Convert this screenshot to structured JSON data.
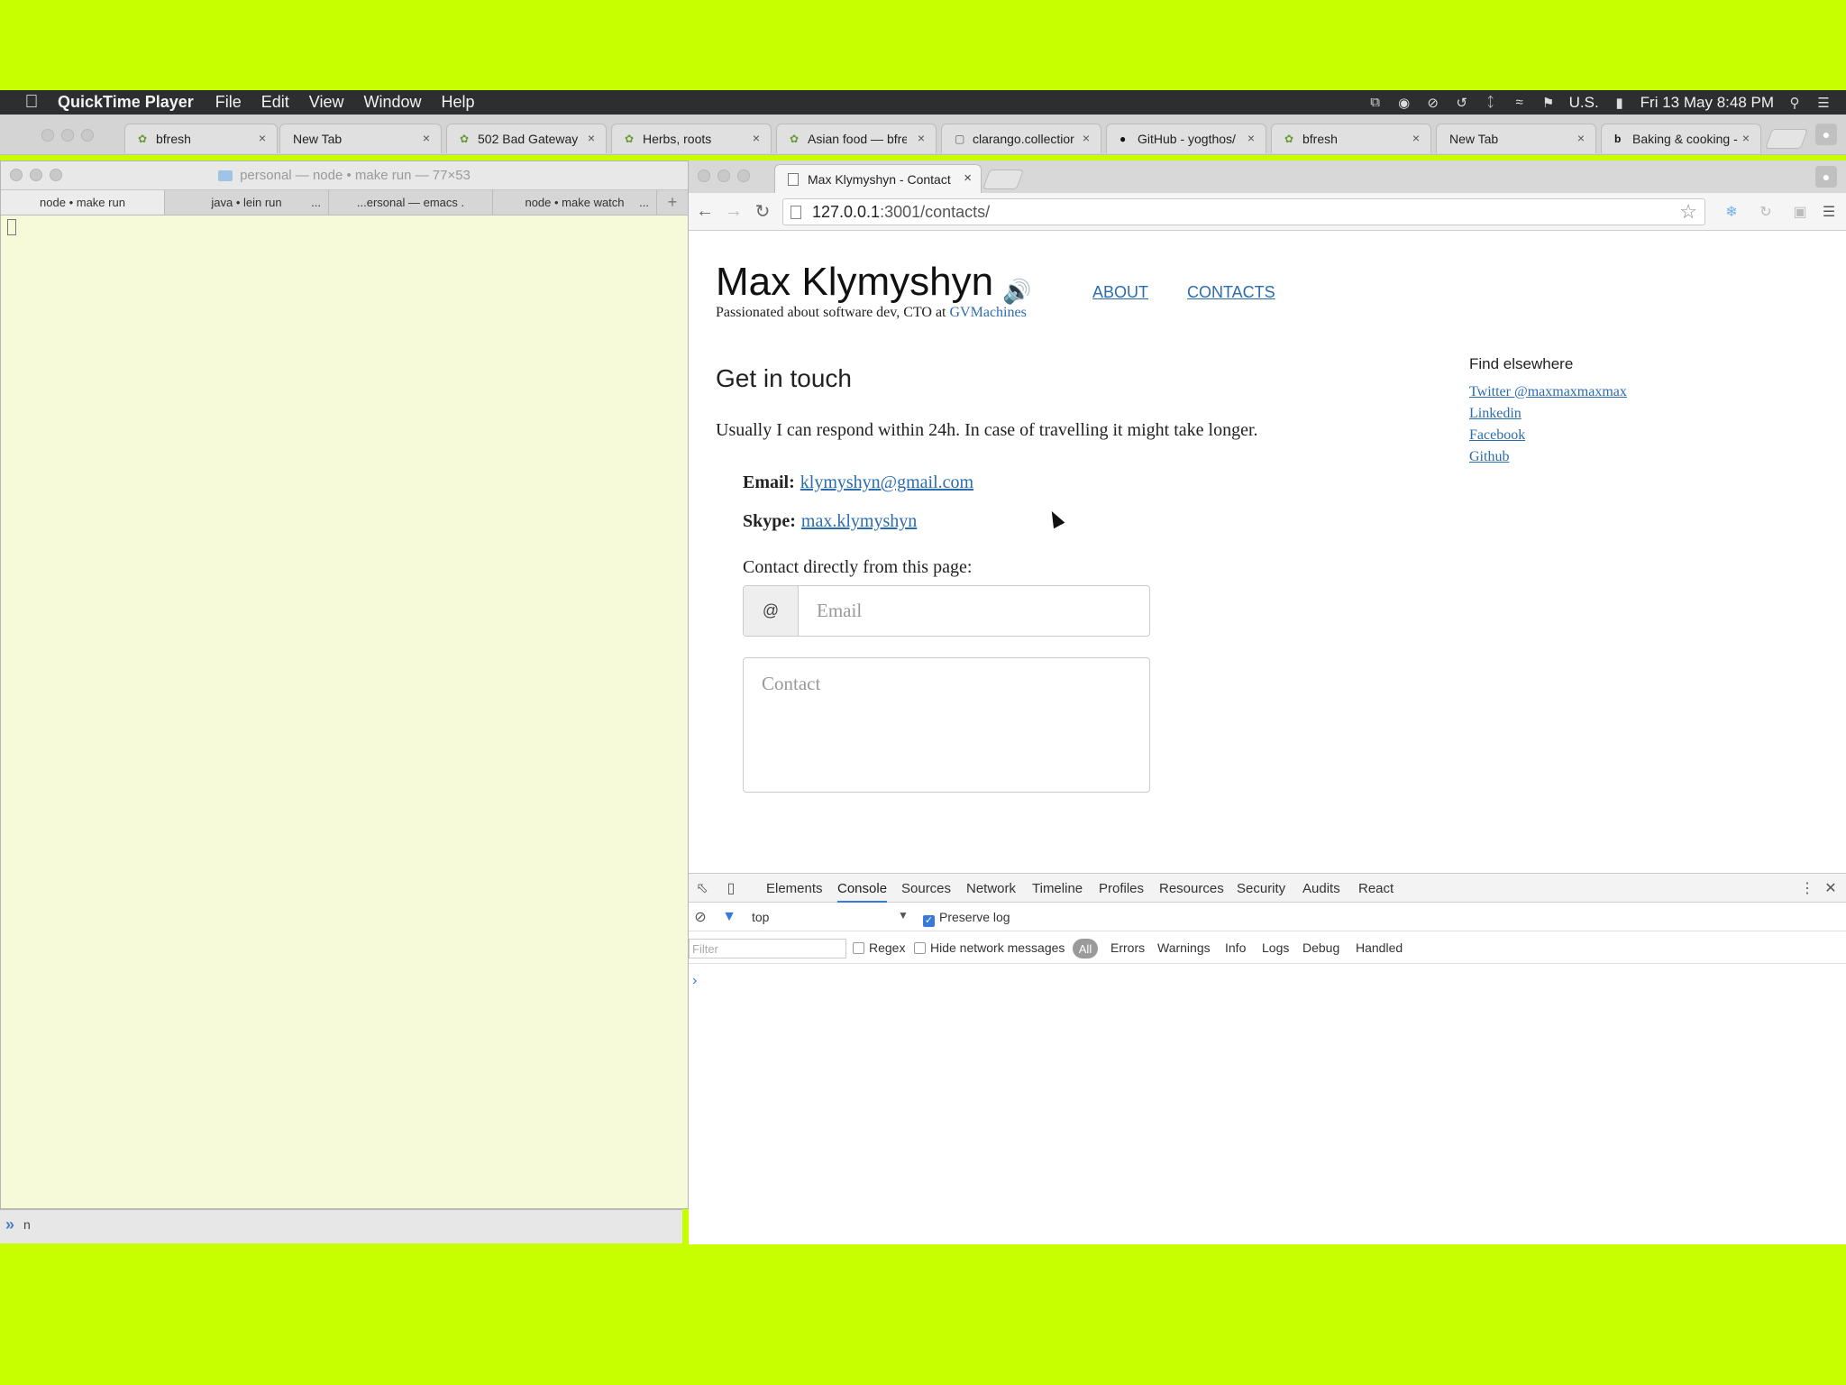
{
  "menubar": {
    "app_name": "QuickTime Player",
    "items": [
      "File",
      "Edit",
      "View",
      "Window",
      "Help"
    ],
    "input_source": "U.S.",
    "clock": "Fri 13 May  8:48 PM"
  },
  "back_tabs": [
    {
      "label": "bfresh",
      "icon": "leaf-icon"
    },
    {
      "label": "New Tab",
      "icon": ""
    },
    {
      "label": "502 Bad Gateway",
      "icon": "leaf-icon"
    },
    {
      "label": "Herbs, roots & spi",
      "icon": "leaf-icon"
    },
    {
      "label": "Asian food — bfres",
      "icon": "leaf-icon"
    },
    {
      "label": "clarango.collectior",
      "icon": "page-icon"
    },
    {
      "label": "GitHub - yogthos/",
      "icon": "github-icon"
    },
    {
      "label": "bfresh",
      "icon": "leaf-icon"
    },
    {
      "label": "New Tab",
      "icon": ""
    },
    {
      "label": "Baking & cooking -",
      "icon": "b-icon"
    }
  ],
  "terminal": {
    "title": "personal — node • make run — 77×53",
    "tabs": [
      "node • make run",
      "java • lein run",
      "...ersonal — emacs .",
      "node • make watch"
    ],
    "bottom_text": "n"
  },
  "chrome": {
    "tab_title": "Max Klymyshyn - Contact",
    "url_host": "127.0.0.1",
    "url_path": ":3001/contacts/"
  },
  "site": {
    "title": "Max Klymyshyn",
    "tagline_prefix": "Passionated about software dev, CTO at ",
    "tagline_link": "GVMachines",
    "nav": [
      "ABOUT",
      "CONTACTS"
    ],
    "find_heading": "Find elsewhere",
    "find_links": [
      "Twitter @maxmaxmaxmax",
      "Linkedin",
      "Facebook",
      "Github"
    ],
    "section_heading": "Get in touch",
    "intro": "Usually I can respond within 24h. In case of travelling it might take longer.",
    "email_label": "Email:",
    "email_value": "klymyshyn@gmail.com",
    "skype_label": "Skype:",
    "skype_value": "max.klymyshyn",
    "form_heading": "Contact directly from this page:",
    "email_addon": "@",
    "email_placeholder": "Email",
    "contact_placeholder": "Contact"
  },
  "devtools": {
    "tabs": [
      "Elements",
      "Console",
      "Sources",
      "Network",
      "Timeline",
      "Profiles",
      "Resources",
      "Security",
      "Audits",
      "React"
    ],
    "active_tab": "Console",
    "context": "top",
    "preserve_log": "Preserve log",
    "filter_placeholder": "Filter",
    "regex": "Regex",
    "hide_network": "Hide network messages",
    "levels": [
      "All",
      "Errors",
      "Warnings",
      "Info",
      "Logs",
      "Debug",
      "Handled"
    ],
    "prompt": "›"
  },
  "colors": {
    "backdrop": "#c8ff00",
    "link": "#2b6cb0",
    "terminal_bg": "#f6fad9"
  }
}
